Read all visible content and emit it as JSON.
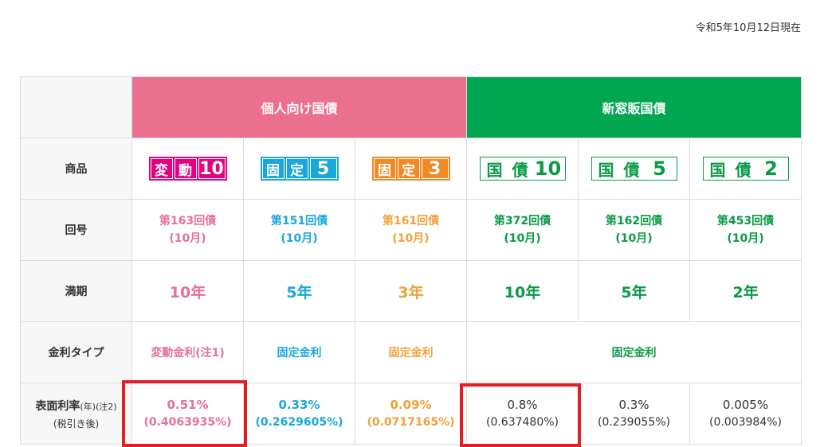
{
  "date": "令和5年10月12日現在",
  "groups": {
    "personal": "個人向け国債",
    "new": "新窓販国債"
  },
  "labels": {
    "product": "商品",
    "series": "回号",
    "maturity": "満期",
    "rate_type": "金利タイプ",
    "coupon_main": "表面利率",
    "coupon_year": "(年)",
    "coupon_note": "(注2)",
    "coupon_sub": "(税引き後)"
  },
  "products": [
    {
      "c1": "変",
      "c2": "動",
      "num": "10",
      "series": "第163回債",
      "month": "(10月)",
      "maturity": "10年",
      "type": "変動金利(注1)",
      "rate": "0.51%",
      "after_tax": "(0.4063935%)"
    },
    {
      "c1": "固",
      "c2": "定",
      "num": "5",
      "series": "第151回債",
      "month": "(10月)",
      "maturity": "5年",
      "type": "固定金利",
      "rate": "0.33%",
      "after_tax": "(0.2629605%)"
    },
    {
      "c1": "固",
      "c2": "定",
      "num": "3",
      "series": "第161回債",
      "month": "(10月)",
      "maturity": "3年",
      "type": "固定金利",
      "rate": "0.09%",
      "after_tax": "(0.0717165%)"
    },
    {
      "c1": "国",
      "c2": "債",
      "num": "10",
      "series": "第372回債",
      "month": "(10月)",
      "maturity": "10年",
      "rate": "0.8%",
      "after_tax": "(0.637480%)"
    },
    {
      "c1": "国",
      "c2": "債",
      "num": "5",
      "series": "第162回債",
      "month": "(10月)",
      "maturity": "5年",
      "rate": "0.3%",
      "after_tax": "(0.239055%)"
    },
    {
      "c1": "国",
      "c2": "債",
      "num": "2",
      "series": "第453回債",
      "month": "(10月)",
      "maturity": "2年",
      "rate": "0.005%",
      "after_tax": "(0.003984%)"
    }
  ],
  "new_rate_type": "固定金利",
  "colors": {
    "pink": "#e4007f",
    "blue": "#1aa7d9",
    "orange": "#f08a24",
    "green": "#0a9a45",
    "highlight": "#e51e25"
  }
}
